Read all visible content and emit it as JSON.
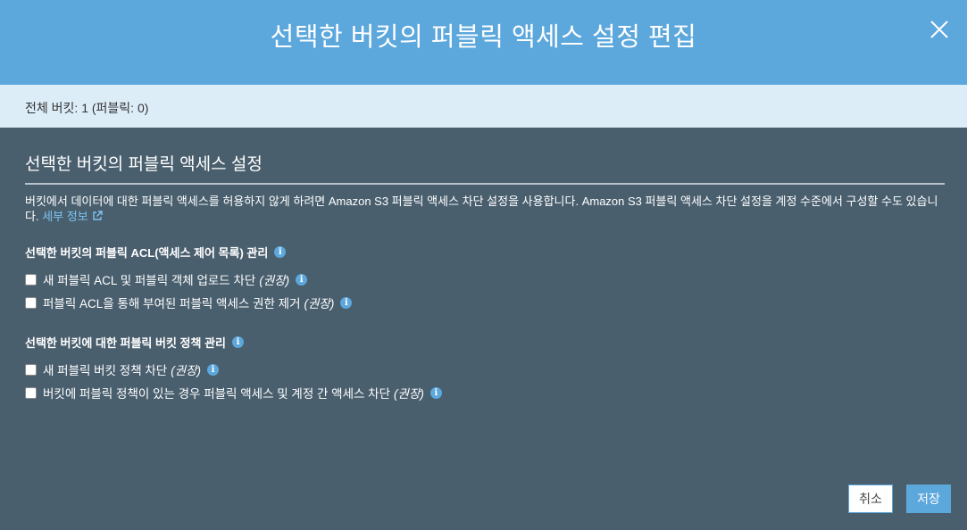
{
  "modal": {
    "title": "선택한 버킷의 퍼블릭 액세스 설정 편집",
    "summary": "전체 버킷: 1 (퍼블릭: 0)"
  },
  "section": {
    "heading": "선택한 버킷의 퍼블릭 액세스 설정",
    "description": "버킷에서 데이터에 대한 퍼블릭 액세스를 허용하지 않게 하려면 Amazon S3 퍼블릭 액세스 차단 설정을 사용합니다. Amazon S3 퍼블릭 액세스 차단 설정을 계정 수준에서 구성할 수도 있습니다.",
    "link_label": "세부 정보"
  },
  "acl_group": {
    "title": "선택한 버킷의 퍼블릭 ACL(액세스 제어 목록) 관리",
    "options": [
      {
        "label": "새 퍼블릭 ACL 및 퍼블릭 객체 업로드 차단",
        "tag": "(권장)",
        "checked": false
      },
      {
        "label": "퍼블릭 ACL을 통해 부여된 퍼블릭 액세스 권한 제거",
        "tag": "(권장)",
        "checked": false
      }
    ]
  },
  "policy_group": {
    "title": "선택한 버킷에 대한 퍼블릭 버킷 정책 관리",
    "options": [
      {
        "label": "새 퍼블릭 버킷 정책 차단",
        "tag": "(권장)",
        "checked": false
      },
      {
        "label": "버킷에 퍼블릭 정책이 있는 경우 퍼블릭 액세스 및 계정 간 액세스 차단",
        "tag": "(권장)",
        "checked": false
      }
    ]
  },
  "buttons": {
    "cancel": "취소",
    "save": "저장"
  },
  "icons": {
    "close": "close-icon",
    "info": "info-icon",
    "external_link": "external-link-icon"
  },
  "colors": {
    "header": "#5ca7dc",
    "summary_bar": "#dcedf8",
    "body": "#4a5f6e",
    "link": "#7cc3f0"
  }
}
